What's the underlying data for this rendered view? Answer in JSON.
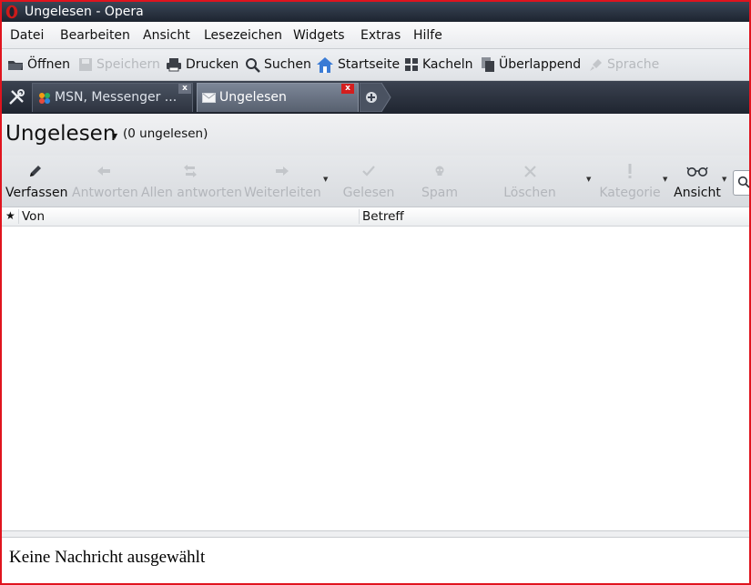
{
  "window": {
    "title": "Ungelesen - Opera"
  },
  "menu": [
    "Datei",
    "Bearbeiten",
    "Ansicht",
    "Lesezeichen",
    "Widgets",
    "Extras",
    "Hilfe"
  ],
  "toolbar": {
    "open": "Öffnen",
    "save": "Speichern",
    "print": "Drucken",
    "search": "Suchen",
    "home": "Startseite",
    "tile": "Kacheln",
    "cascade": "Überlappend",
    "voice": "Sprache"
  },
  "tabs": [
    {
      "label": "MSN, Messenger ...",
      "close": "x",
      "active": false
    },
    {
      "label": "Ungelesen",
      "close": "x",
      "active": true
    }
  ],
  "heading": {
    "title": "Ungelesen",
    "count": "(0 ungelesen)"
  },
  "mail_toolbar": {
    "compose": "Verfassen",
    "reply": "Antworten",
    "reply_all": "Allen antworten",
    "forward": "Weiterleiten",
    "read": "Gelesen",
    "spam": "Spam",
    "delete": "Löschen",
    "category": "Kategorie",
    "view": "Ansicht"
  },
  "columns": {
    "from": "Von",
    "subject": "Betreff"
  },
  "preview": {
    "message": "Keine Nachricht ausgewählt"
  },
  "colors": {
    "frame_border": "#e0141e",
    "titlebar": "#1d2430",
    "tabstrip": "#1f2530",
    "opera_red": "#cc1b1b"
  }
}
